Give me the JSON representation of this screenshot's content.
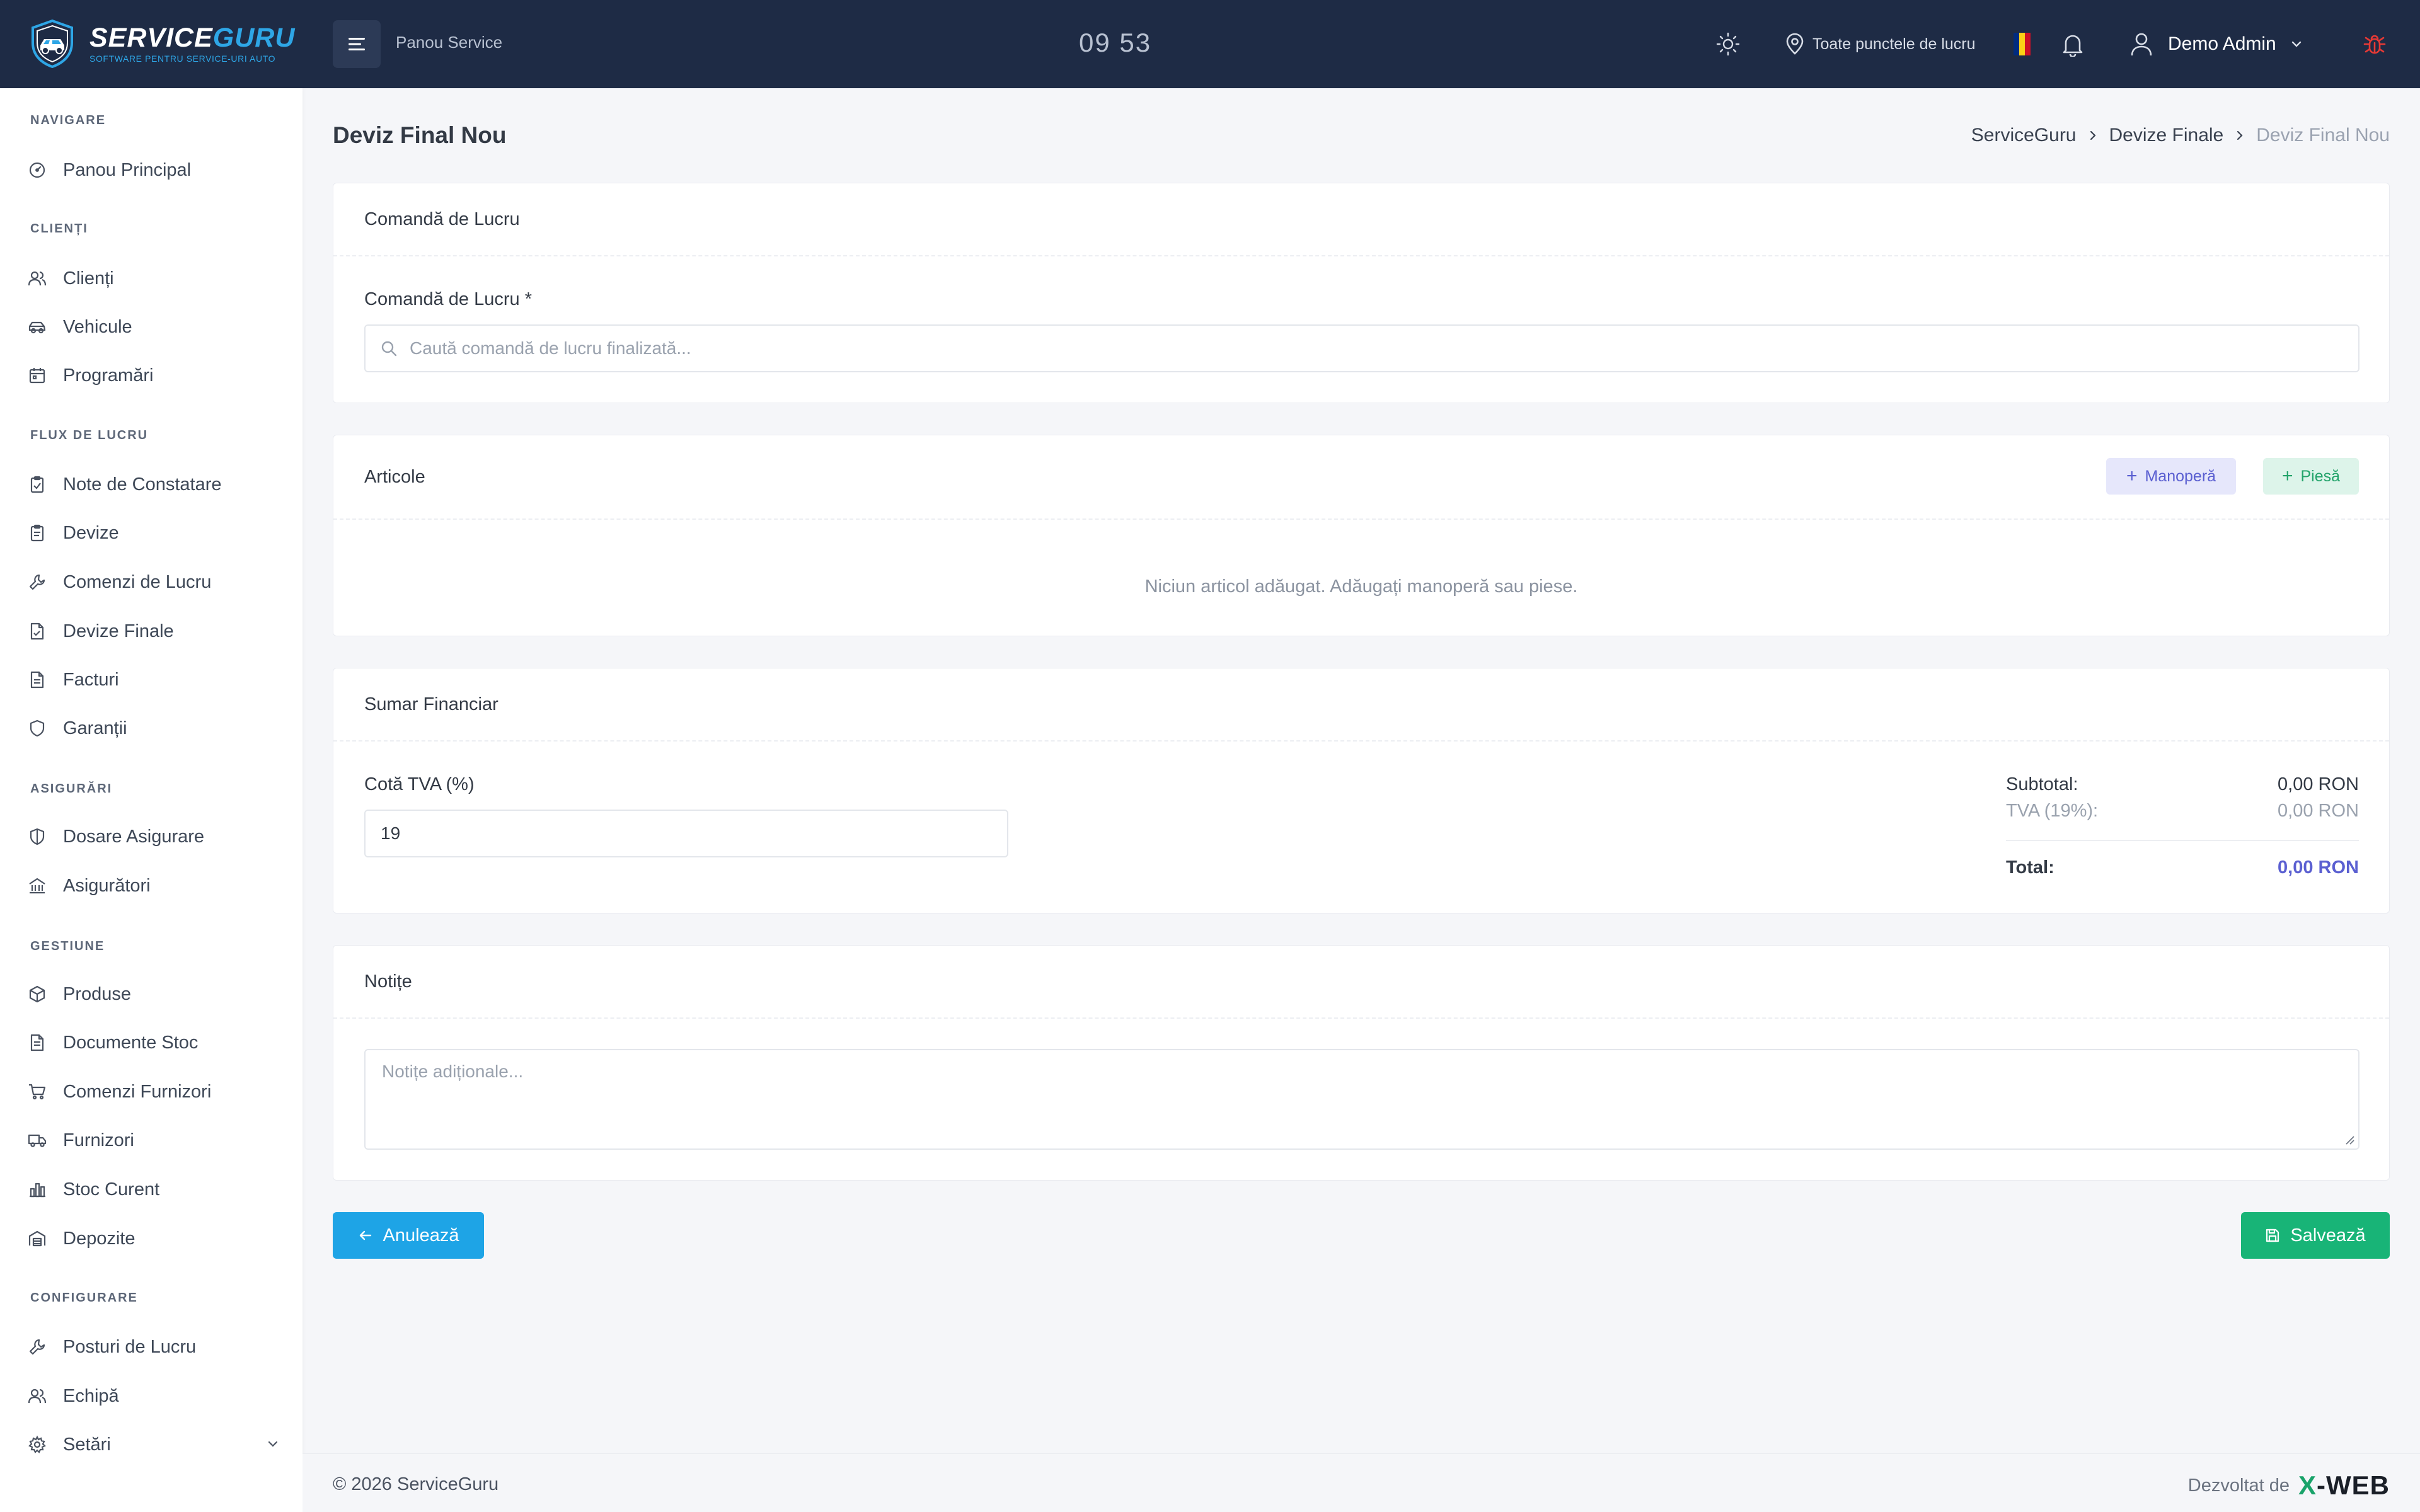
{
  "topbar": {
    "logo_main": "SERVICE",
    "logo_accent": "GURU",
    "logo_sub": "SOFTWARE PENTRU SERVICE-URI AUTO",
    "title": "Panou Service",
    "clock": "09 53",
    "location": "Toate punctele de lucru",
    "user": "Demo Admin"
  },
  "sidebar": {
    "sections": {
      "nav": "NAVIGARE",
      "clients": "CLIENȚI",
      "workflow": "FLUX DE LUCRU",
      "insurance": "ASIGURĂRI",
      "management": "GESTIUNE",
      "config": "CONFIGURARE"
    },
    "items": {
      "dashboard": "Panou Principal",
      "clients": "Clienți",
      "vehicles": "Vehicule",
      "appointments": "Programări",
      "inspection_notes": "Note de Constatare",
      "estimates": "Devize",
      "work_orders": "Comenzi de Lucru",
      "final_estimates": "Devize Finale",
      "invoices": "Facturi",
      "warranties": "Garanții",
      "insurance_files": "Dosare Asigurare",
      "insurers": "Asigurători",
      "products": "Produse",
      "stock_docs": "Documente Stoc",
      "supplier_orders": "Comenzi Furnizori",
      "suppliers": "Furnizori",
      "current_stock": "Stoc Curent",
      "warehouses": "Depozite",
      "workstations": "Posturi de Lucru",
      "team": "Echipă",
      "settings": "Setări"
    }
  },
  "page": {
    "title": "Deviz Final Nou",
    "breadcrumb": [
      "ServiceGuru",
      "Devize Finale",
      "Deviz Final Nou"
    ]
  },
  "work_order_card": {
    "header": "Comandă de Lucru",
    "label": "Comandă de Lucru *",
    "placeholder": "Caută comandă de lucru finalizată..."
  },
  "items_card": {
    "header": "Articole",
    "labor_button": "Manoperă",
    "part_button": "Piesă",
    "empty": "Niciun articol adăugat. Adăugați manoperă sau piese."
  },
  "summary_card": {
    "header": "Sumar Financiar",
    "vat_label": "Cotă TVA (%)",
    "vat_value": "19",
    "subtotal_label": "Subtotal:",
    "subtotal_value": "0,00 RON",
    "vat_line_label": "TVA (19%):",
    "vat_line_value": "0,00 RON",
    "total_label": "Total:",
    "total_value": "0,00 RON"
  },
  "notes_card": {
    "header": "Notițe",
    "placeholder": "Notițe adiționale..."
  },
  "actions": {
    "cancel": "Anulează",
    "save": "Salvează"
  },
  "footer": {
    "copyright": "© 2026 ServiceGuru",
    "developed_by": "Dezvoltat de",
    "brand_x": "X",
    "brand_rest": "-WEB"
  },
  "colors": {
    "topbar": "#1e2b45",
    "accent_blue": "#1ea4e6",
    "accent_green": "#18b477",
    "total_purple": "#5a5fd1",
    "bug_red": "#e53935"
  }
}
